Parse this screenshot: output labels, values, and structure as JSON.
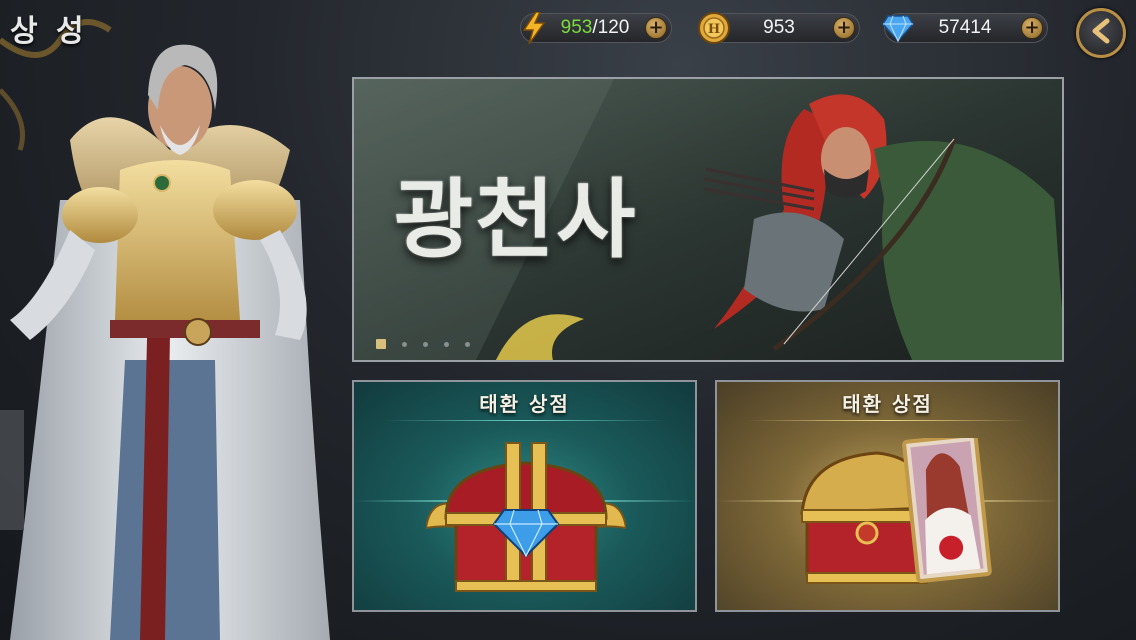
{
  "header": {
    "title": "상 성"
  },
  "resources": {
    "energy": {
      "current": "953",
      "separator": "/",
      "max": "120",
      "icon": "lightning-icon"
    },
    "gold": {
      "value": "953",
      "icon": "gold-coin-icon"
    },
    "gems": {
      "value": "57414",
      "icon": "diamond-icon"
    },
    "plus_label": "+"
  },
  "banner": {
    "title": "광천사",
    "page_count": 5,
    "active_page": 1
  },
  "shops": [
    {
      "title": "태환 상점",
      "theme": "teal",
      "icon": "gem-chest-icon"
    },
    {
      "title": "태환 상점",
      "theme": "gold",
      "icon": "card-chest-icon"
    }
  ],
  "colors": {
    "accent_gold": "#b98e45",
    "energy_green": "#7ddc3c",
    "teal_card": "#1a5a5a",
    "gold_card": "#7e6838"
  }
}
